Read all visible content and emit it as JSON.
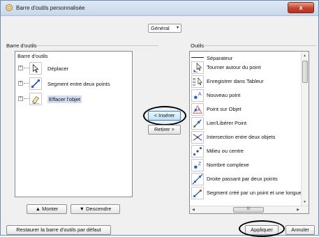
{
  "window": {
    "title": "Barre d'outils personnalisée",
    "close_symbol": "x"
  },
  "category": {
    "selected": "Général",
    "arrow": "▾"
  },
  "left_panel": {
    "header": "Barre d'outils",
    "root_label": "Barre d'outils",
    "items": [
      {
        "label": "Déplacer",
        "icon": "cursor-icon"
      },
      {
        "label": "Segment entre deux points",
        "icon": "segment-icon"
      },
      {
        "label": "Effacer l'objet",
        "icon": "eraser-icon"
      }
    ],
    "move_up": "▲ Monter",
    "move_down": "▼ Descendre"
  },
  "center": {
    "insert": "< Insérer",
    "remove": "Retirer >"
  },
  "right_panel": {
    "header": "Outils",
    "items": [
      {
        "label": "Séparateur",
        "icon": "separator-line"
      },
      {
        "label": "Tourner autour du point",
        "icon": "rotate-around-point-icon"
      },
      {
        "label": "Enregistrer dans Tableur",
        "icon": "record-to-spreadsheet-icon",
        "icon_text": [
          "36",
          "24",
          "12"
        ]
      },
      {
        "label": "Nouveau point",
        "icon": "new-point-icon",
        "icon_text": [
          "A"
        ]
      },
      {
        "label": "Point sur Objet",
        "icon": "point-on-object-icon",
        "icon_text": [
          "A"
        ]
      },
      {
        "label": "Lier/Libérer Point",
        "icon": "attach-detach-point-icon"
      },
      {
        "label": "Intersection entre deux objets",
        "icon": "intersection-icon"
      },
      {
        "label": "Milieu ou centre",
        "icon": "midpoint-icon"
      },
      {
        "label": "Nombre complexe",
        "icon": "complex-number-icon",
        "icon_text": [
          "Z"
        ]
      },
      {
        "label": "Droite passant par deux points",
        "icon": "line-through-two-points-icon"
      },
      {
        "label": "Segment créé par un point et une longueur",
        "icon": "segment-fixed-length-icon"
      }
    ],
    "hscroll_grip": "III"
  },
  "footer": {
    "reset": "Restaurer la barre d'outils par défaut",
    "apply": "Appliquer",
    "cancel": "Annuler"
  },
  "colors": {
    "point_blue": "#2a5fd0",
    "line_blue": "#123a9a",
    "highlight": "#d3dcf0"
  }
}
